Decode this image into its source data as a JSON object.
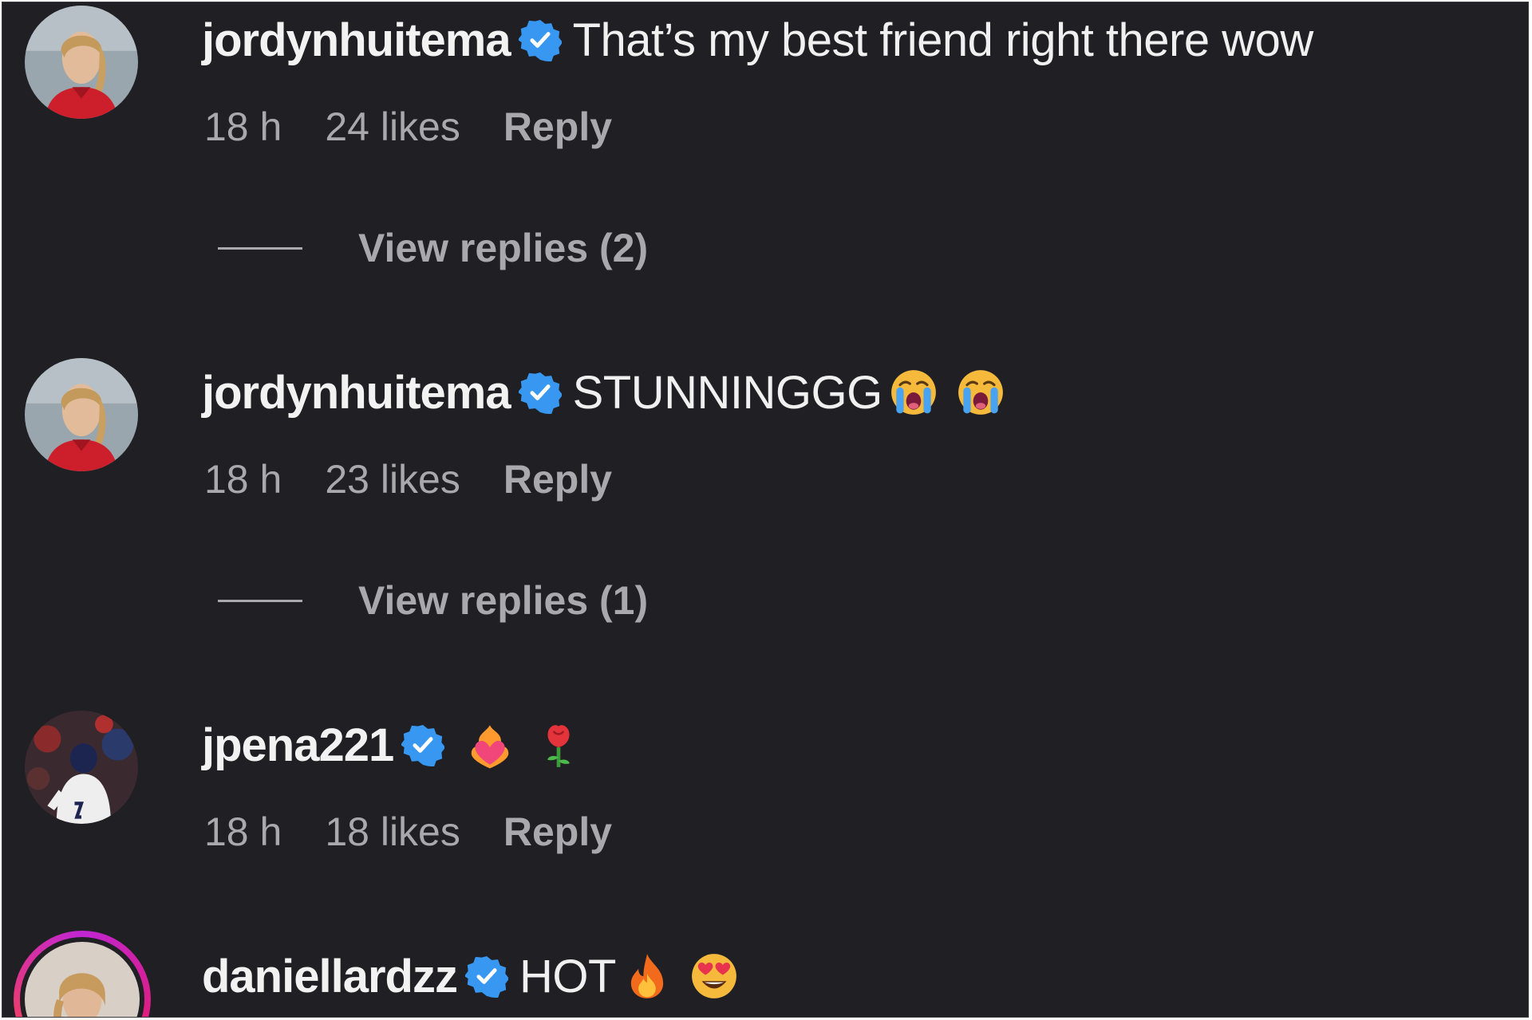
{
  "comments": [
    {
      "username": "jordynhuitema",
      "verified": true,
      "text": "That’s my best friend right there wow",
      "emojis": [],
      "time": "18 h",
      "likes": "24 likes",
      "reply_label": "Reply",
      "view_replies": "View replies (2)",
      "avatar_icon": "portrait-avatar-icon"
    },
    {
      "username": "jordynhuitema",
      "verified": true,
      "text": "STUNNINGGG",
      "emojis": [
        "loudly-crying-face-emoji",
        "loudly-crying-face-emoji"
      ],
      "time": "18 h",
      "likes": "23 likes",
      "reply_label": "Reply",
      "view_replies": "View replies (1)",
      "avatar_icon": "portrait-avatar-icon"
    },
    {
      "username": "jpena221",
      "verified": true,
      "text": "",
      "emojis": [
        "heart-on-fire-emoji",
        "rose-emoji"
      ],
      "time": "18 h",
      "likes": "18 likes",
      "reply_label": "Reply",
      "avatar_icon": "baseball-player-avatar-icon"
    },
    {
      "username": "daniellardzz",
      "verified": true,
      "text": "HOT",
      "emojis": [
        "fire-emoji",
        "heart-eyes-emoji"
      ],
      "avatar_icon": "story-ring-avatar-icon"
    }
  ],
  "colors": {
    "background": "#1f1f24",
    "username": "#f2f2f2",
    "meta": "#a8a8ad",
    "verified_badge": "#3897f0",
    "story_ring": "#c026d3"
  }
}
